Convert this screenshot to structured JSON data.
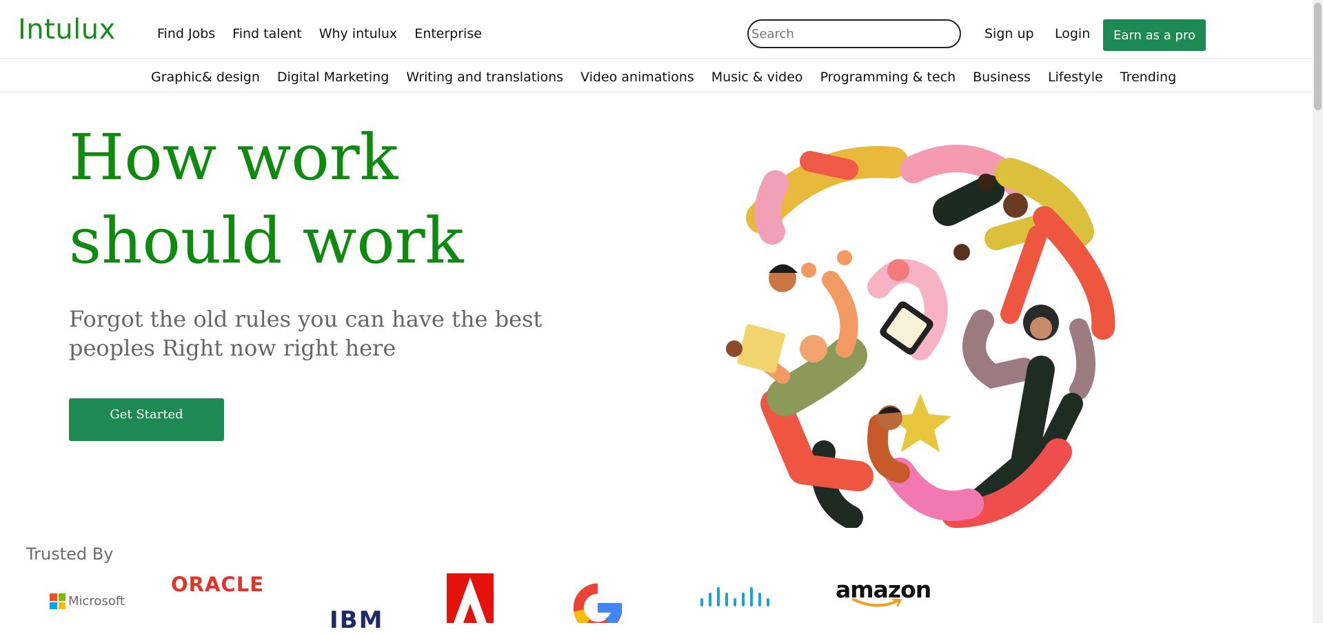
{
  "brand": {
    "logo_text": "Intulux",
    "accent_color": "#1c8a52",
    "logo_color": "#1a8a1a",
    "headline_color": "#0e8a0e"
  },
  "nav": {
    "links": [
      "Find Jobs",
      "Find talent",
      "Why intulux",
      "Enterprise"
    ],
    "search_placeholder": "Search",
    "sign_up": "Sign up",
    "login": "Login",
    "earn_button": "Earn as a pro"
  },
  "categories": [
    "Graphic& design",
    "Digital Marketing",
    "Writing and translations",
    "Video animations",
    "Music & video",
    "Programming & tech",
    "Business",
    "Lifestyle",
    "Trending"
  ],
  "hero": {
    "title": "How work should work",
    "subtitle": "Forgot the old rules you can have the best peoples Right now right here",
    "cta": "Get Started",
    "illustration": "people-circle-illustration"
  },
  "trusted": {
    "heading": "Trusted By",
    "logos": {
      "microsoft": "Microsoft",
      "oracle": "ORACLE",
      "ibm": "IBM",
      "adobe": "Adobe",
      "google": "Google",
      "cisco": "CISCO",
      "amazon": "amazon"
    }
  }
}
